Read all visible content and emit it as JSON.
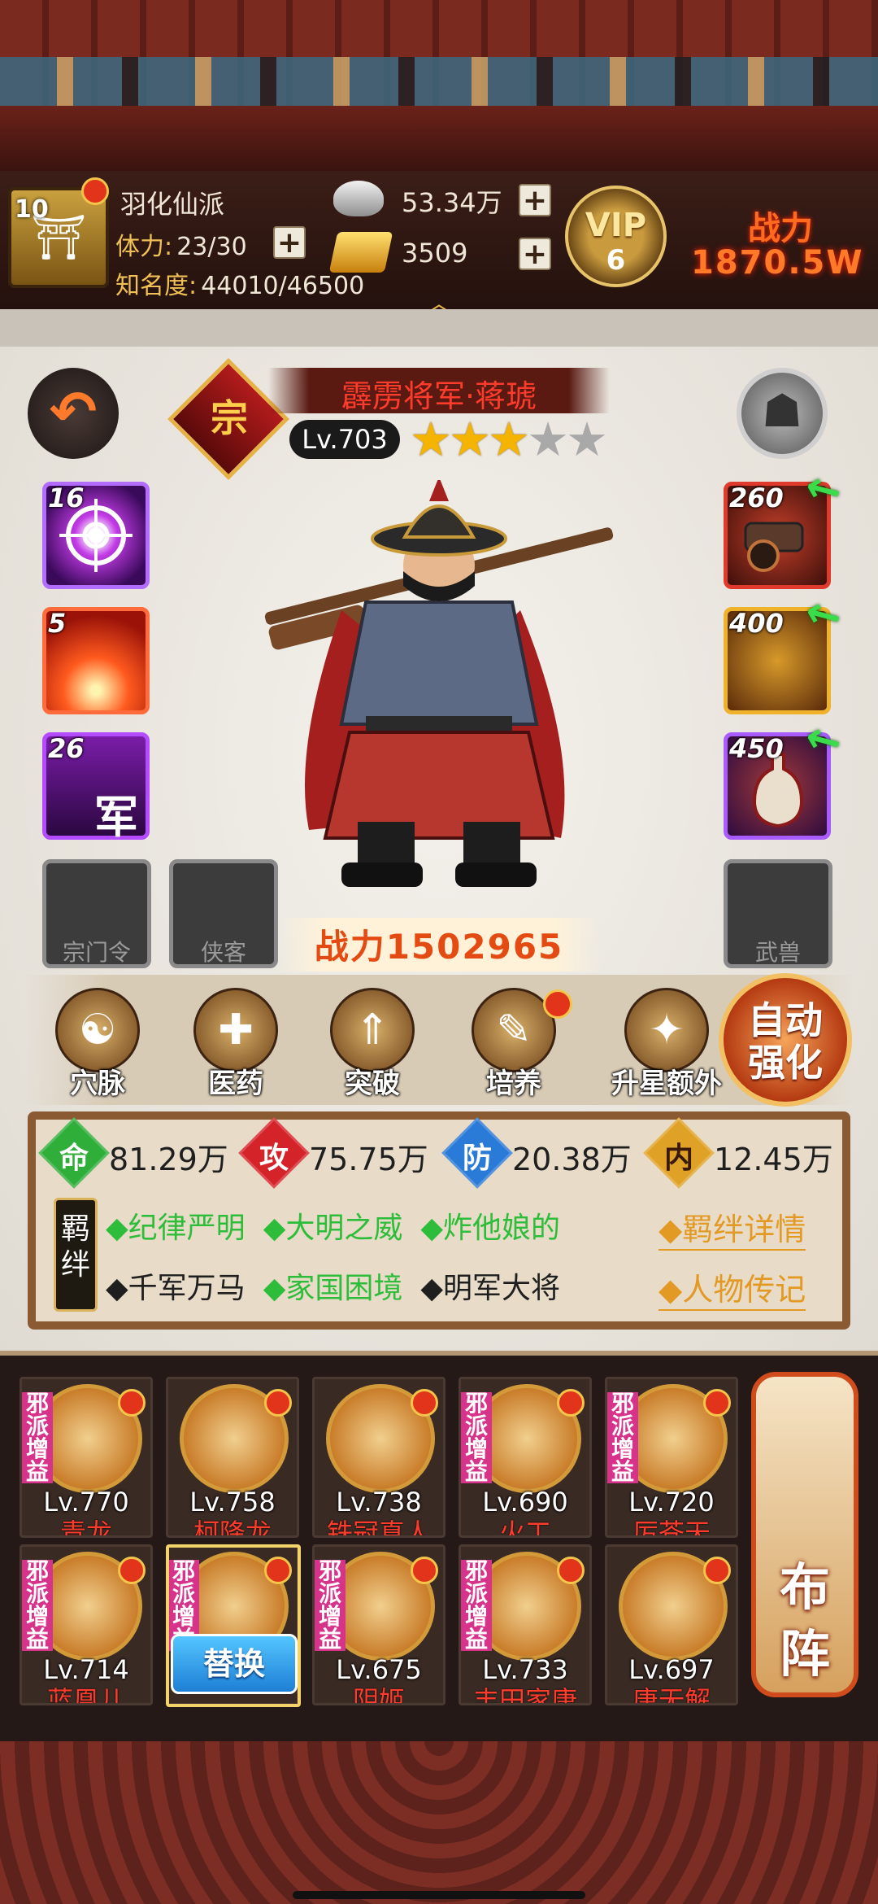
{
  "header": {
    "sect_name": "羽化仙派",
    "sect_level": "10",
    "stamina_label": "体力:",
    "stamina_value": "23/30",
    "fame_label": "知名度:",
    "fame_value": "44010/46500",
    "silver": "53.34万",
    "gold": "3509",
    "vip_label": "VIP",
    "vip_level": "6",
    "power_label": "战力",
    "power_value": "1870.5W"
  },
  "hero": {
    "quality": "宗",
    "name": "霹雳将军·蒋琥",
    "level": "Lv.703",
    "stars_filled": 3,
    "stars_total": 5,
    "power": "战力1502965"
  },
  "skills": [
    {
      "level": "16",
      "icon": "target-icon"
    },
    {
      "level": "5",
      "icon": "explosion-icon"
    },
    {
      "level": "26",
      "icon": "army-icon",
      "char": "军"
    }
  ],
  "equipment": [
    {
      "level": "260",
      "icon": "cannon-icon"
    },
    {
      "level": "400",
      "icon": "armor-icon"
    },
    {
      "level": "450",
      "icon": "vase-icon"
    }
  ],
  "empty_slots": {
    "sect_token": "宗门令",
    "knight": "侠客",
    "beast": "武兽"
  },
  "functions": [
    {
      "label": "穴脉",
      "icon": "meridian-icon"
    },
    {
      "label": "医药",
      "icon": "medicine-icon"
    },
    {
      "label": "突破",
      "icon": "breakthrough-icon"
    },
    {
      "label": "培养",
      "icon": "training-icon"
    },
    {
      "label": "升星额外",
      "icon": "star-up-icon"
    }
  ],
  "auto_strengthen": {
    "line1": "自动",
    "line2": "强化"
  },
  "stats": [
    {
      "char": "命",
      "value": "81.29万",
      "color": "#2fae3a"
    },
    {
      "char": "攻",
      "value": "75.75万",
      "color": "#d5232a"
    },
    {
      "char": "防",
      "value": "20.38万",
      "color": "#2a7ad8"
    },
    {
      "char": "内",
      "value": "12.45万",
      "color": "#e0a226"
    }
  ],
  "fetters": {
    "badge": "羁绊",
    "row1": [
      "◆纪律严明",
      "◆大明之威",
      "◆炸他娘的"
    ],
    "row2": [
      "◆千军万马",
      "◆家国困境",
      "◆明军大将"
    ],
    "row2_active": [
      false,
      true,
      false
    ],
    "detail_link": "◆羁绊详情",
    "bio_link": "◆人物传记"
  },
  "roster": [
    {
      "level": "Lv.770",
      "name": "青龙",
      "tag": "邪派增益"
    },
    {
      "level": "Lv.758",
      "name": "柯降龙",
      "tag": ""
    },
    {
      "level": "Lv.738",
      "name": "铁冠真人",
      "tag": ""
    },
    {
      "level": "Lv.690",
      "name": "火工",
      "tag": "邪派增益"
    },
    {
      "level": "Lv.720",
      "name": "厉苍天",
      "tag": "邪派增益"
    },
    {
      "level": "Lv.714",
      "name": "蓝凰儿",
      "tag": "邪派增益"
    },
    {
      "level": "",
      "name": "",
      "tag": "邪派增益"
    },
    {
      "level": "Lv.675",
      "name": "阴姬",
      "tag": "邪派增益"
    },
    {
      "level": "Lv.733",
      "name": "丰田家康",
      "tag": "邪派增益"
    },
    {
      "level": "Lv.697",
      "name": "唐无解",
      "tag": ""
    }
  ],
  "replace_label": "替换",
  "formation_label": "布\n阵"
}
